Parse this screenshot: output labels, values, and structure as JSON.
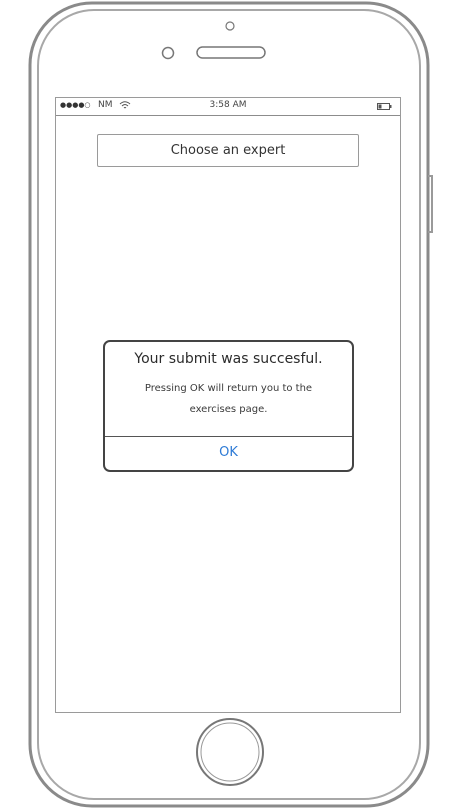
{
  "status_bar": {
    "signal": "●●●●○",
    "carrier": "NM",
    "time": "3:58 AM"
  },
  "screen": {
    "expert_button_label": "Choose an expert"
  },
  "dialog": {
    "title": "Your submit was succesful.",
    "message_line1": "Pressing OK will return you to the",
    "message_line2": "exercises page.",
    "ok_label": "OK"
  },
  "colors": {
    "accent": "#2e7bd6",
    "frame": "#9a9a9a"
  },
  "icons": {
    "wifi": "wifi-icon",
    "battery": "battery-icon",
    "home": "home-button-icon",
    "camera": "front-camera-icon",
    "speaker": "speaker-icon"
  }
}
